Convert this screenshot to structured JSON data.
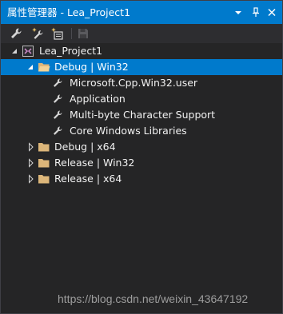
{
  "window": {
    "title": "属性管理器 - Lea_Project1",
    "controls": {
      "dropdown_icon": "dropdown-arrow",
      "pin_icon": "pin",
      "close_icon": "close"
    }
  },
  "toolbar": {
    "buttons": [
      {
        "icon": "wrench-properties"
      },
      {
        "icon": "add-new-property-sheet"
      },
      {
        "icon": "add-existing-property-sheet"
      },
      {
        "icon": "save-disabled"
      }
    ]
  },
  "tree": {
    "root": {
      "label": "Lea_Project1",
      "icon": "project",
      "expanded": true
    },
    "configs": [
      {
        "label": "Debug | Win32",
        "icon": "folder-open",
        "expanded": true,
        "selected": true,
        "children": [
          {
            "label": "Microsoft.Cpp.Win32.user",
            "icon": "wrench"
          },
          {
            "label": "Application",
            "icon": "wrench"
          },
          {
            "label": "Multi-byte Character Support",
            "icon": "wrench"
          },
          {
            "label": "Core Windows Libraries",
            "icon": "wrench"
          }
        ]
      },
      {
        "label": "Debug | x64",
        "icon": "folder",
        "expanded": false
      },
      {
        "label": "Release | Win32",
        "icon": "folder",
        "expanded": false
      },
      {
        "label": "Release | x64",
        "icon": "folder",
        "expanded": false
      }
    ]
  },
  "watermark": "https://blog.csdn.net/weixin_43647192",
  "colors": {
    "titlebar": "#007acc",
    "selection": "#007acc",
    "background": "#252526",
    "text": "#f1f1f1",
    "folder": "#dcb67a"
  }
}
